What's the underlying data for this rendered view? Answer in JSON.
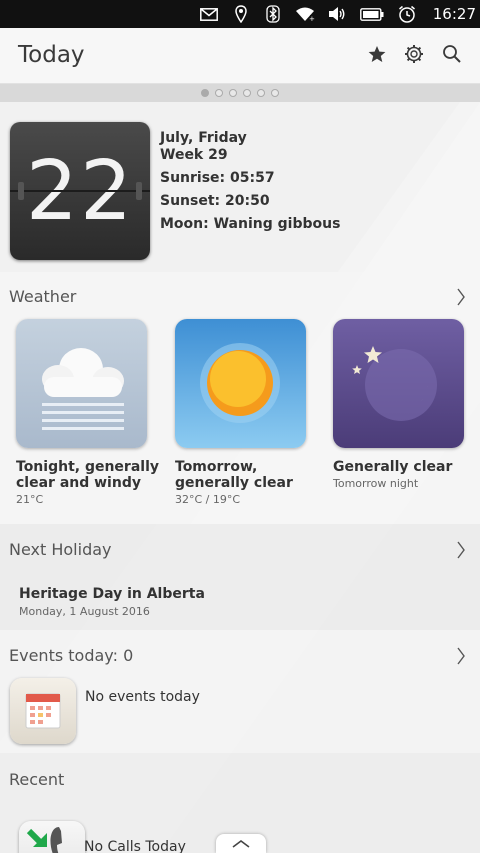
{
  "status_bar": {
    "time": "16:27",
    "icons": [
      "mail-icon",
      "location-icon",
      "bluetooth-icon",
      "wifi-icon",
      "volume-icon",
      "battery-icon",
      "alarm-icon"
    ]
  },
  "header": {
    "title": "Today",
    "actions": [
      "star-icon",
      "settings-icon",
      "search-icon"
    ]
  },
  "pager": {
    "count": 6,
    "active_index": 0
  },
  "date": {
    "day": "22",
    "line1": "July, Friday",
    "line2": "Week 29",
    "sunrise": "Sunrise: 05:57",
    "sunset": "Sunset: 20:50",
    "moon": "Moon: Waning gibbous"
  },
  "weather": {
    "title": "Weather",
    "cards": [
      {
        "icon": "cloudy-windy-icon",
        "name": "Tonight, generally clear and windy",
        "sub": "21°C",
        "color": "#b8c7d8"
      },
      {
        "icon": "sun-icon",
        "name": "Tomorrow, generally clear",
        "sub": "32°C / 19°C",
        "color": "#4a9bd8"
      },
      {
        "icon": "moon-stars-icon",
        "name": "Generally clear",
        "sub": "Tomorrow night",
        "color": "#5e4d8c"
      }
    ]
  },
  "holiday": {
    "title": "Next Holiday",
    "name": "Heritage Day in Alberta",
    "date": "Monday, 1 August 2016"
  },
  "events": {
    "title": "Events today: 0",
    "empty_text": "No events today"
  },
  "recent": {
    "title": "Recent",
    "calls_text": "No Calls Today"
  }
}
